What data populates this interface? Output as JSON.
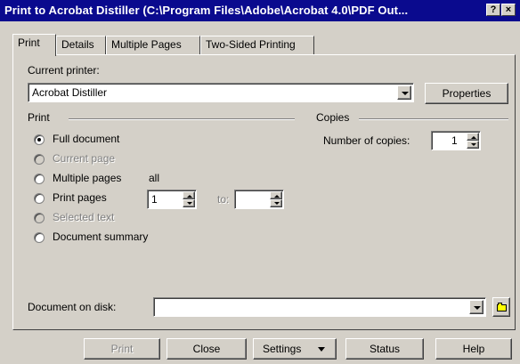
{
  "window": {
    "title": "Print to Acrobat Distiller   (C:\\Program Files\\Adobe\\Acrobat 4.0\\PDF Out...",
    "help_button": "?",
    "close_button": "×"
  },
  "tabs": [
    {
      "label": "Print",
      "active": true
    },
    {
      "label": "Details",
      "active": false
    },
    {
      "label": "Multiple Pages",
      "active": false
    },
    {
      "label": "Two-Sided Printing",
      "active": false
    }
  ],
  "printer": {
    "label": "Current printer:",
    "value": "Acrobat Distiller",
    "properties_label": "Properties"
  },
  "print_group": {
    "label": "Print",
    "options": [
      {
        "label": "Full document",
        "selected": true,
        "enabled": true
      },
      {
        "label": "Current page",
        "selected": false,
        "enabled": false
      },
      {
        "label": "Multiple pages",
        "selected": false,
        "enabled": true,
        "note": "all"
      },
      {
        "label": "Print pages",
        "selected": false,
        "enabled": true
      },
      {
        "label": "Selected text",
        "selected": false,
        "enabled": false
      },
      {
        "label": "Document summary",
        "selected": false,
        "enabled": true
      }
    ],
    "from_value": "1",
    "to_label": "to:",
    "to_value": ""
  },
  "copies": {
    "label": "Copies",
    "number_label": "Number of copies:",
    "value": "1"
  },
  "document_on_disk": {
    "label": "Document on disk:",
    "value": ""
  },
  "buttons": {
    "print": "Print",
    "close": "Close",
    "settings": "Settings",
    "status": "Status",
    "help": "Help"
  },
  "colors": {
    "title_bar": "#0a0a8e",
    "face": "#d4d0c8"
  }
}
